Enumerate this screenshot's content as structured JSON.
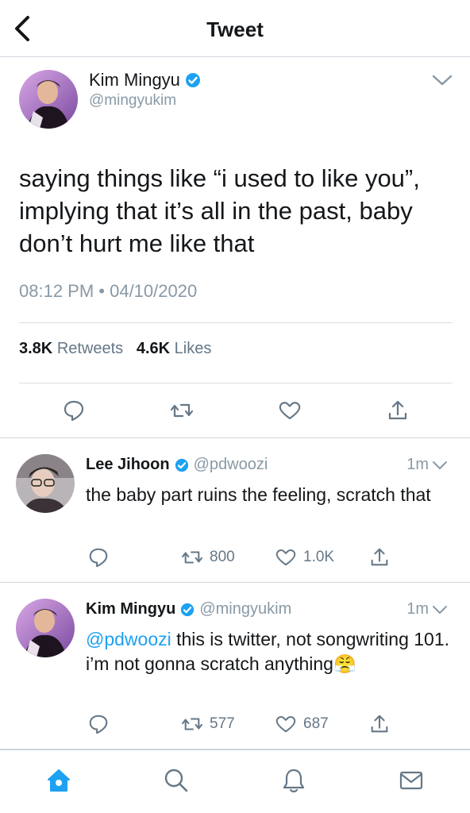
{
  "header": {
    "title": "Tweet"
  },
  "main_tweet": {
    "author_name": "Kim Mingyu",
    "author_handle": "@mingyukim",
    "text": "saying things like “i used to like you”, implying that it’s all in the past, baby don’t hurt me like that",
    "timestamp": "08:12 PM • 04/10/2020",
    "retweets_count": "3.8K",
    "retweets_label": "Retweets",
    "likes_count": "4.6K",
    "likes_label": "Likes"
  },
  "replies": [
    {
      "author_name": "Lee Jihoon",
      "author_handle": "@pdwoozi",
      "time": "1m",
      "text": "the baby part ruins the feeling, scratch that",
      "retweets": "800",
      "likes": "1.0K"
    },
    {
      "author_name": "Kim Mingyu",
      "author_handle": "@mingyukim",
      "time": "1m",
      "mention": "@pdwoozi",
      "text": " this is twitter, not songwriting 101. i’m not gonna scratch anything",
      "emoji": "😤",
      "retweets": "577",
      "likes": "687"
    }
  ],
  "colors": {
    "accent": "#1da1f2",
    "verified": "#1da1f2",
    "muted": "#8899a6",
    "text": "#14171a"
  },
  "icons": {
    "back": "chevron-left-icon",
    "caret": "chevron-down-icon",
    "reply": "reply-icon",
    "retweet": "retweet-icon",
    "like": "heart-icon",
    "share": "share-icon",
    "nav": [
      "home-icon",
      "search-icon",
      "notifications-icon",
      "messages-icon"
    ]
  }
}
